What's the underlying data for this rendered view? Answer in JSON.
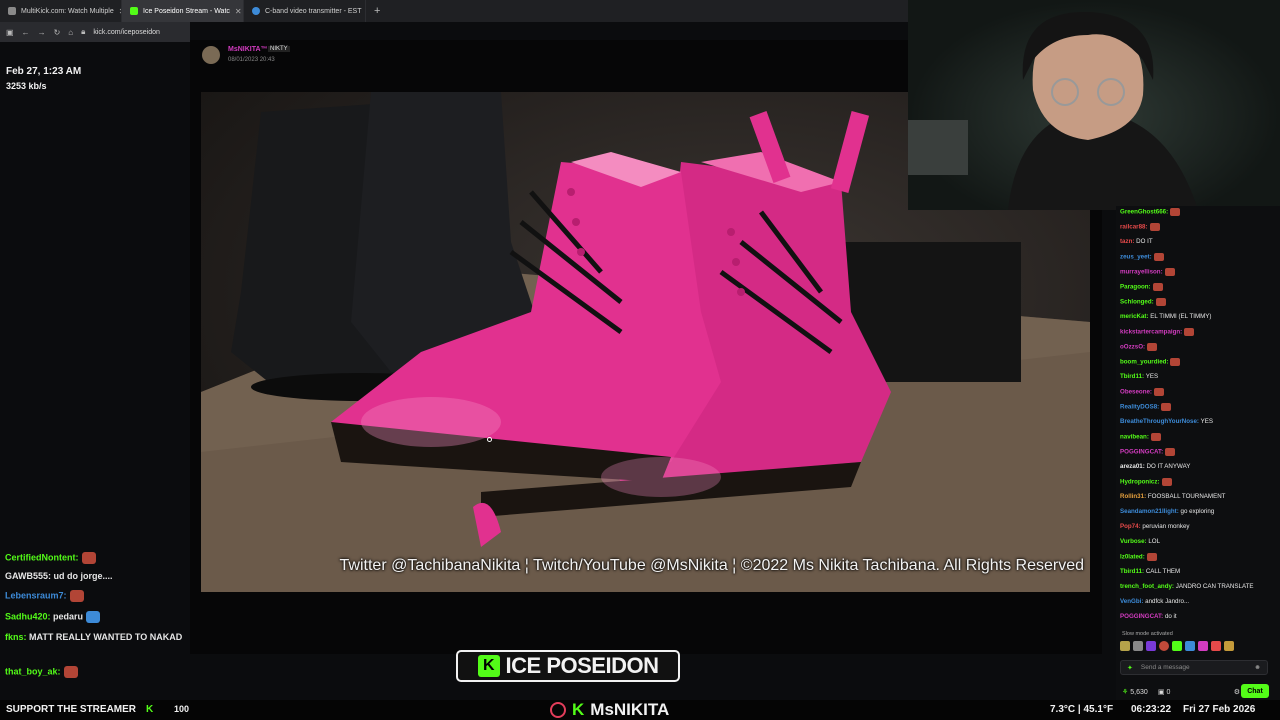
{
  "browser": {
    "tabs": [
      {
        "label": "MultiKick.com: Watch Multiple",
        "color": "#8a8a8a"
      },
      {
        "label": "Ice Poseidon Stream - Watc",
        "color": "#53fc18"
      },
      {
        "label": "C-band video transmitter - EST",
        "color": "#3d8bd8"
      }
    ],
    "url": "kick.com/iceposeidon"
  },
  "overlay_info": {
    "date": "Feb 27, 1:23 AM",
    "bitrate": "3253 kb/s"
  },
  "left_chat": [
    {
      "user": "CertifiedNontent:",
      "text": "",
      "color": "#53fc18",
      "emote": true
    },
    {
      "user": "GAWB555:",
      "text": "ud do jorge....",
      "color": "#e8e8e8",
      "emote": false
    },
    {
      "user": "Lebensraum7:",
      "text": "",
      "color": "#3d8bd8",
      "emote": true
    },
    {
      "user": "Sadhu420:",
      "text": "pedaru",
      "color": "#53fc18",
      "emote": true
    },
    {
      "user": "fkns:",
      "text": "MATT REALLY WANTED TO NAKAD",
      "color": "#53fc18",
      "emote": false
    },
    {
      "user": "that_boy_ak:",
      "text": "",
      "color": "#53fc18",
      "emote": true
    }
  ],
  "card": {
    "author": "MsNIKITA™",
    "badge": "NIKTY",
    "timestamp": "08/01/2023 20:43"
  },
  "photo_caption": "Twitter @TachibanaNikita ¦ Twitch/YouTube @MsNikita ¦ ©2022 Ms Nikita Tachibana. All Rights Reserved",
  "right_chat": [
    {
      "user": "GreenGhost666:",
      "text": "",
      "color": "#53fc18",
      "emote": true
    },
    {
      "user": "railcar88:",
      "text": "",
      "color": "#e64a4a",
      "emote": true
    },
    {
      "user": "tazn:",
      "text": "DO IT",
      "color": "#e64a4a",
      "emote": false
    },
    {
      "user": "zeus_yeet:",
      "text": "",
      "color": "#3d8bd8",
      "emote": true
    },
    {
      "user": "murrayellison:",
      "text": "",
      "color": "#d33cc0",
      "emote": true
    },
    {
      "user": "Paragoon:",
      "text": "",
      "color": "#53fc18",
      "emote": true
    },
    {
      "user": "Schlonged:",
      "text": "",
      "color": "#53fc18",
      "emote": true
    },
    {
      "user": "mericKat:",
      "text": "EL TIMMI (EL TIMMY)",
      "color": "#53fc18",
      "emote": false
    },
    {
      "user": "kickstartercampaign:",
      "text": "",
      "color": "#d33cc0",
      "emote": true
    },
    {
      "user": "oOzzsO:",
      "text": "",
      "color": "#d33cc0",
      "emote": true
    },
    {
      "user": "boom_yourdied:",
      "text": "",
      "color": "#53fc18",
      "emote": true
    },
    {
      "user": "Tbird11:",
      "text": "YES",
      "color": "#53fc18",
      "emote": false
    },
    {
      "user": "Obeseone:",
      "text": "",
      "color": "#d33cc0",
      "emote": true
    },
    {
      "user": "RealityDOS8:",
      "text": "",
      "color": "#3d8bd8",
      "emote": true
    },
    {
      "user": "BreatheThroughYourNose:",
      "text": "YES",
      "color": "#3d8bd8",
      "emote": false
    },
    {
      "user": "navibean:",
      "text": "",
      "color": "#53fc18",
      "emote": true
    },
    {
      "user": "POGGINGCAT:",
      "text": "",
      "color": "#d33cc0",
      "emote": true
    },
    {
      "user": "areza01:",
      "text": "DO IT ANYWAY",
      "color": "#e8e8e8",
      "emote": false
    },
    {
      "user": "Hydroponicz:",
      "text": "",
      "color": "#53fc18",
      "emote": true
    },
    {
      "user": "Rollin31:",
      "text": "FOOSBALL TOURNAMENT",
      "color": "#e6a03d",
      "emote": false
    },
    {
      "user": "Seandamon21Ilight:",
      "text": "go exploring",
      "color": "#3d8bd8",
      "emote": false
    },
    {
      "user": "Pop74:",
      "text": "peruvian monkey",
      "color": "#e64a4a",
      "emote": false
    },
    {
      "user": "Vurbose:",
      "text": "LOL",
      "color": "#53fc18",
      "emote": false
    },
    {
      "user": "Iz0lated:",
      "text": "",
      "color": "#53fc18",
      "emote": true
    },
    {
      "user": "Tbird11:",
      "text": "CALL THEM",
      "color": "#53fc18",
      "emote": false
    },
    {
      "user": "trench_foot_andy:",
      "text": "JANDRO CAN TRANSLATE",
      "color": "#53fc18",
      "emote": false
    },
    {
      "user": "VenGbi:",
      "text": "andfck Jandro...",
      "color": "#3d8bd8",
      "emote": false
    },
    {
      "user": "POGGINGCAT:",
      "text": "do it",
      "color": "#d33cc0",
      "emote": false
    }
  ],
  "chat_footer": {
    "slow_mode": "Slow mode activated",
    "placeholder": "Send a message",
    "viewers": "5,630",
    "gifts": "0",
    "chat_button": "Chat"
  },
  "bottom": {
    "support_label": "SUPPORT THE STREAMER",
    "support_count": "100",
    "brand_top": "ICE POSEIDON",
    "brand_bottom": "MsNIKITA",
    "weather": "7.3°C | 45.1°F",
    "time": "06:23:22",
    "date": "Fri 27 Feb 2026"
  },
  "colors": {
    "kick_green": "#53fc18",
    "boot_pink": "#e1318f"
  }
}
